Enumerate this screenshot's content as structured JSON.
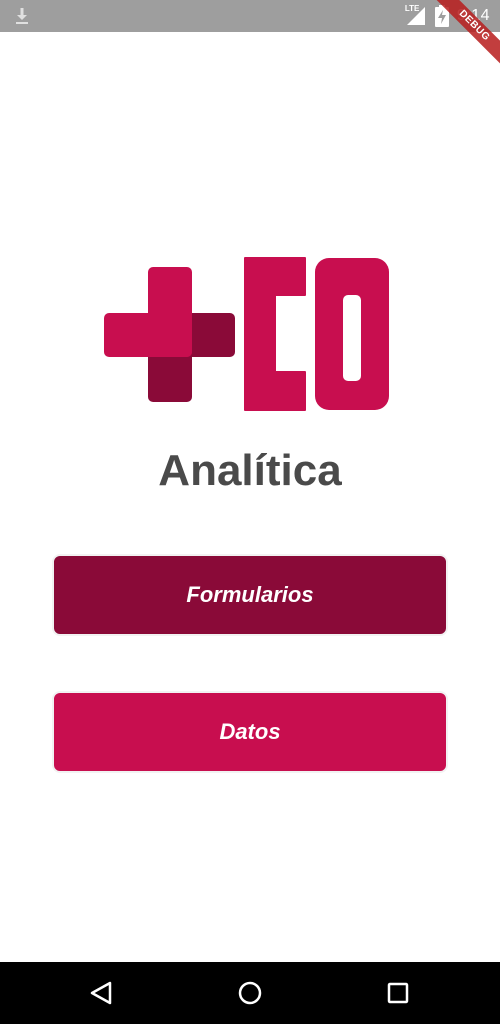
{
  "status_bar": {
    "network_label": "LTE",
    "time": "9:14",
    "icons": [
      "download-icon",
      "signal-icon",
      "battery-charging-icon"
    ]
  },
  "debug_banner": {
    "label": "DEBUG"
  },
  "logo": {
    "text": "+CO",
    "colors": {
      "primary": "#c80e4f",
      "dark": "#8a0a38"
    }
  },
  "title": "Analítica",
  "buttons": {
    "forms_label": "Formularios",
    "data_label": "Datos"
  },
  "colors": {
    "forms_button": "#8a0a38",
    "data_button": "#c80e4f",
    "title_text": "#4a4a4a",
    "status_bar": "#9e9e9e",
    "nav_bar": "#000000"
  },
  "nav_bar": {
    "icons": [
      "back-icon",
      "home-icon",
      "recents-icon"
    ]
  }
}
